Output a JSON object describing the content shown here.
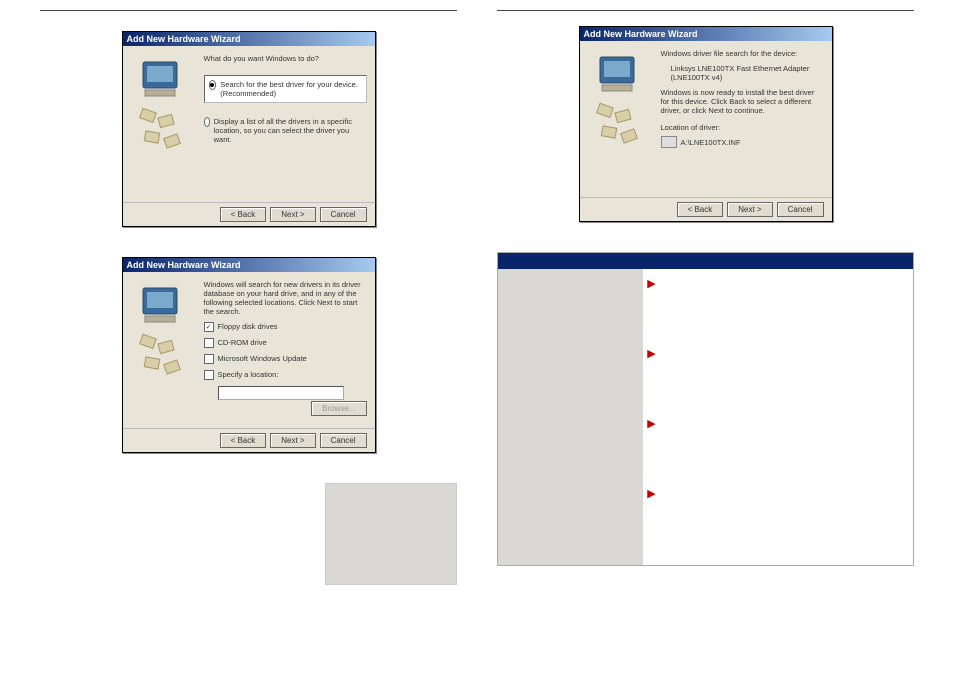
{
  "wizard_title": "Add New Hardware Wizard",
  "left_page": {
    "wizard1": {
      "prompt": "What do you want Windows to do?",
      "opt_search": "Search for the best driver for your device. (Recommended)",
      "opt_display": "Display a list of all the drivers in a specific location, so you can select the driver you want."
    },
    "wizard2": {
      "intro": "Windows will search for new drivers in its driver database on your hard drive, and in any of the following selected locations. Click Next to start the search.",
      "opt_floppy": "Floppy disk drives",
      "opt_cdrom": "CD-ROM drive",
      "opt_update": "Microsoft Windows Update",
      "opt_specify": "Specify a location:",
      "browse": "Browse..."
    }
  },
  "right_page": {
    "wizard3": {
      "heading": "Windows driver file search for the device:",
      "device": "Linksys LNE100TX Fast Ethernet Adapter (LNE100TX v4)",
      "body": "Windows is now ready to install the best driver for this device. Click Back to select a different driver, or click Next to continue.",
      "loc_label": "Location of driver:",
      "loc_value": "A:\\LNE100TX.INF"
    }
  },
  "buttons": {
    "back": "< Back",
    "next": "Next >",
    "cancel": "Cancel"
  }
}
